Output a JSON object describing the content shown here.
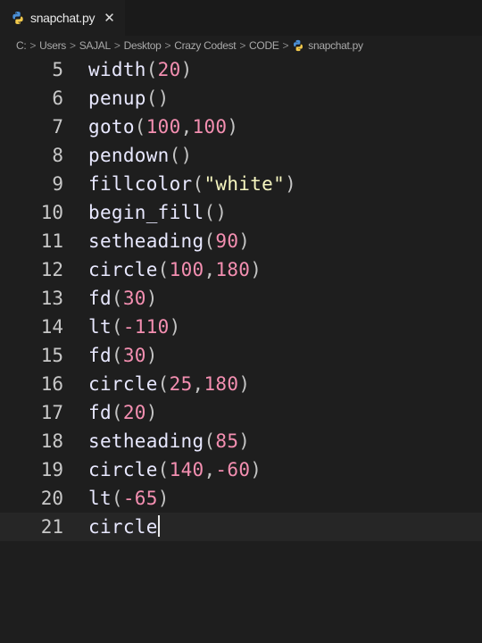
{
  "tab": {
    "filename": "snapchat.py",
    "close_glyph": "✕",
    "icon": "python-file-icon"
  },
  "breadcrumb": {
    "parts": [
      "C:",
      "Users",
      "SAJAL",
      "Desktop",
      "Crazy Codest",
      "CODE"
    ],
    "separator": ">",
    "file": "snapchat.py"
  },
  "editor": {
    "active_line": 21,
    "lines": [
      {
        "n": "5",
        "tokens": [
          [
            "fn",
            "width"
          ],
          [
            "pn",
            "("
          ],
          [
            "num",
            "20"
          ],
          [
            "pn",
            ")"
          ]
        ]
      },
      {
        "n": "6",
        "tokens": [
          [
            "fn",
            "penup"
          ],
          [
            "pn",
            "()"
          ]
        ]
      },
      {
        "n": "7",
        "tokens": [
          [
            "fn",
            "goto"
          ],
          [
            "pn",
            "("
          ],
          [
            "num",
            "100"
          ],
          [
            "pn",
            ","
          ],
          [
            "num",
            "100"
          ],
          [
            "pn",
            ")"
          ]
        ]
      },
      {
        "n": "8",
        "tokens": [
          [
            "fn",
            "pendown"
          ],
          [
            "pn",
            "()"
          ]
        ]
      },
      {
        "n": "9",
        "tokens": [
          [
            "fn",
            "fillcolor"
          ],
          [
            "pn",
            "("
          ],
          [
            "str",
            "\"white\""
          ],
          [
            "pn",
            ")"
          ]
        ]
      },
      {
        "n": "10",
        "tokens": [
          [
            "fn",
            "begin_fill"
          ],
          [
            "pn",
            "()"
          ]
        ]
      },
      {
        "n": "11",
        "tokens": [
          [
            "fn",
            "setheading"
          ],
          [
            "pn",
            "("
          ],
          [
            "num",
            "90"
          ],
          [
            "pn",
            ")"
          ]
        ]
      },
      {
        "n": "12",
        "tokens": [
          [
            "fn",
            "circle"
          ],
          [
            "pn",
            "("
          ],
          [
            "num",
            "100"
          ],
          [
            "pn",
            ","
          ],
          [
            "num",
            "180"
          ],
          [
            "pn",
            ")"
          ]
        ]
      },
      {
        "n": "13",
        "tokens": [
          [
            "fn",
            "fd"
          ],
          [
            "pn",
            "("
          ],
          [
            "num",
            "30"
          ],
          [
            "pn",
            ")"
          ]
        ]
      },
      {
        "n": "14",
        "tokens": [
          [
            "fn",
            "lt"
          ],
          [
            "pn",
            "("
          ],
          [
            "op",
            "-"
          ],
          [
            "num",
            "110"
          ],
          [
            "pn",
            ")"
          ]
        ]
      },
      {
        "n": "15",
        "tokens": [
          [
            "fn",
            "fd"
          ],
          [
            "pn",
            "("
          ],
          [
            "num",
            "30"
          ],
          [
            "pn",
            ")"
          ]
        ]
      },
      {
        "n": "16",
        "tokens": [
          [
            "fn",
            "circle"
          ],
          [
            "pn",
            "("
          ],
          [
            "num",
            "25"
          ],
          [
            "pn",
            ","
          ],
          [
            "num",
            "180"
          ],
          [
            "pn",
            ")"
          ]
        ]
      },
      {
        "n": "17",
        "tokens": [
          [
            "fn",
            "fd"
          ],
          [
            "pn",
            "("
          ],
          [
            "num",
            "20"
          ],
          [
            "pn",
            ")"
          ]
        ]
      },
      {
        "n": "18",
        "tokens": [
          [
            "fn",
            "setheading"
          ],
          [
            "pn",
            "("
          ],
          [
            "num",
            "85"
          ],
          [
            "pn",
            ")"
          ]
        ]
      },
      {
        "n": "19",
        "tokens": [
          [
            "fn",
            "circle"
          ],
          [
            "pn",
            "("
          ],
          [
            "num",
            "140"
          ],
          [
            "pn",
            ","
          ],
          [
            "op",
            "-"
          ],
          [
            "num",
            "60"
          ],
          [
            "pn",
            ")"
          ]
        ]
      },
      {
        "n": "20",
        "tokens": [
          [
            "fn",
            "lt"
          ],
          [
            "pn",
            "("
          ],
          [
            "op",
            "-"
          ],
          [
            "num",
            "65"
          ],
          [
            "pn",
            ")"
          ]
        ]
      },
      {
        "n": "21",
        "tokens": [
          [
            "fn",
            "circle"
          ]
        ],
        "cursor": true
      }
    ]
  },
  "colors": {
    "background": "#1e1e1e",
    "tabbar": "#1a1a1a",
    "function": "#e8e8ff",
    "number": "#f48fb1",
    "string": "#f6f6c0"
  }
}
